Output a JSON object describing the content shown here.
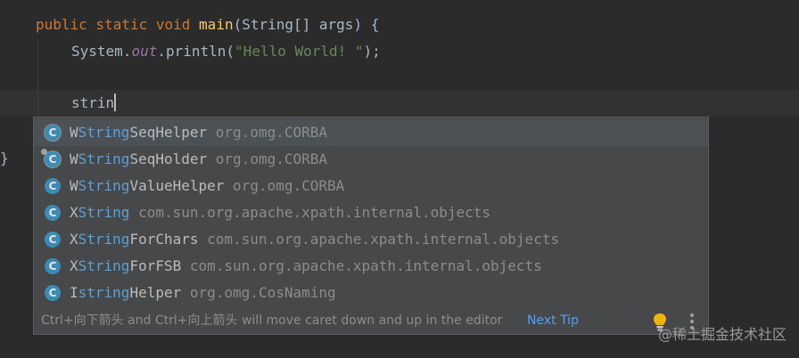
{
  "editor": {
    "line1": {
      "kw1": "public",
      "kw2": "static",
      "kw3": "void",
      "method": "main",
      "params": "(String[] args) {"
    },
    "line2": {
      "obj": "System.",
      "field": "out",
      "call": ".println(",
      "string": "\"Hello World! \"",
      "end": ");"
    },
    "line4": {
      "typed": "strin"
    },
    "closing_brace": "}"
  },
  "completion": {
    "items": [
      {
        "icon": "class-icon",
        "prefix": "W",
        "match": "String",
        "rest": "SeqHelper",
        "pkg": "org.omg.CORBA",
        "selected": true
      },
      {
        "icon": "class-icon",
        "prefix": "W",
        "match": "String",
        "rest": "SeqHolder",
        "pkg": "org.omg.CORBA"
      },
      {
        "icon": "class-icon",
        "prefix": "W",
        "match": "String",
        "rest": "ValueHelper",
        "pkg": "org.omg.CORBA"
      },
      {
        "icon": "class-icon",
        "prefix": "X",
        "match": "String",
        "rest": "",
        "pkg": "com.sun.org.apache.xpath.internal.objects"
      },
      {
        "icon": "class-icon",
        "prefix": "X",
        "match": "String",
        "rest": "ForChars",
        "pkg": "com.sun.org.apache.xpath.internal.objects"
      },
      {
        "icon": "class-icon",
        "prefix": "X",
        "match": "String",
        "rest": "ForFSB",
        "pkg": "com.sun.org.apache.xpath.internal.objects"
      },
      {
        "icon": "class-icon",
        "prefix": "I",
        "match": "string",
        "rest": "Helper",
        "pkg": "org.omg.CosNaming"
      }
    ],
    "icon_letter": "C",
    "footer_hint": "Ctrl+向下箭头 and Ctrl+向上箭头 will move caret down and up in the editor",
    "next_tip": "Next Tip"
  },
  "watermark": "@稀土掘金技术社区",
  "colors": {
    "background": "#2b2b2b",
    "keyword": "#cc7832",
    "method": "#ffc66d",
    "string": "#6a8759",
    "static_field": "#9876aa",
    "match_highlight": "#5f9fd6",
    "popup_bg": "#46484a",
    "link": "#589df6"
  }
}
